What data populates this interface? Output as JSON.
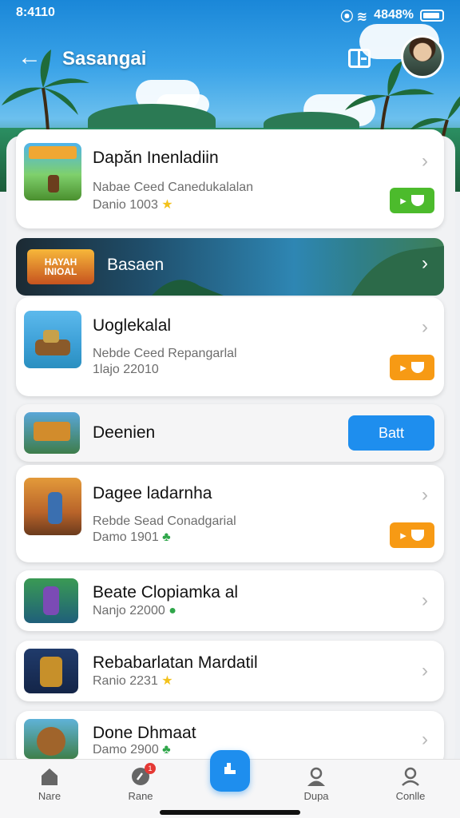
{
  "status": {
    "time": "8:4110",
    "battery": "4848%"
  },
  "appbar": {
    "title": "Sasangai"
  },
  "games": [
    {
      "name": "Dapăn Inenladiin",
      "sub": "Nabae Ceed Canedukalalan",
      "meta": "Danio 1003",
      "meta_icon": "★",
      "action": "green"
    },
    {
      "name": "Uoglekalal",
      "sub": "Nebde Ceed Repangarlal",
      "meta": "1lajo 22010",
      "action": "orange"
    },
    {
      "name": "Dagee ladarnha",
      "sub": "Rebde Sead Conadgarial",
      "meta": "Damo 1901",
      "meta_icon": "♣",
      "action": "orange"
    },
    {
      "name": "Beate Clopiamka al",
      "meta": "Nanjo 22000",
      "meta_icon": "●"
    },
    {
      "name": "Rebabarlatan Mardatil",
      "meta": "Ranio 2231",
      "meta_icon": "★"
    },
    {
      "name": "Done Dhmaat",
      "meta": "Damo 2900",
      "meta_icon": "♣"
    }
  ],
  "banner": {
    "logo": "HAYAH INIOAL",
    "label": "Basaen"
  },
  "feature": {
    "name": "Deenien",
    "button": "Batt"
  },
  "nav": [
    {
      "label": "Nare",
      "icon": "home-icon"
    },
    {
      "label": "Rane",
      "icon": "chat-icon",
      "badge": "1"
    },
    {
      "label": "",
      "icon": "game-icon"
    },
    {
      "label": "Dupa",
      "icon": "user-icon"
    },
    {
      "label": "Conlle",
      "icon": "profile-icon"
    }
  ]
}
